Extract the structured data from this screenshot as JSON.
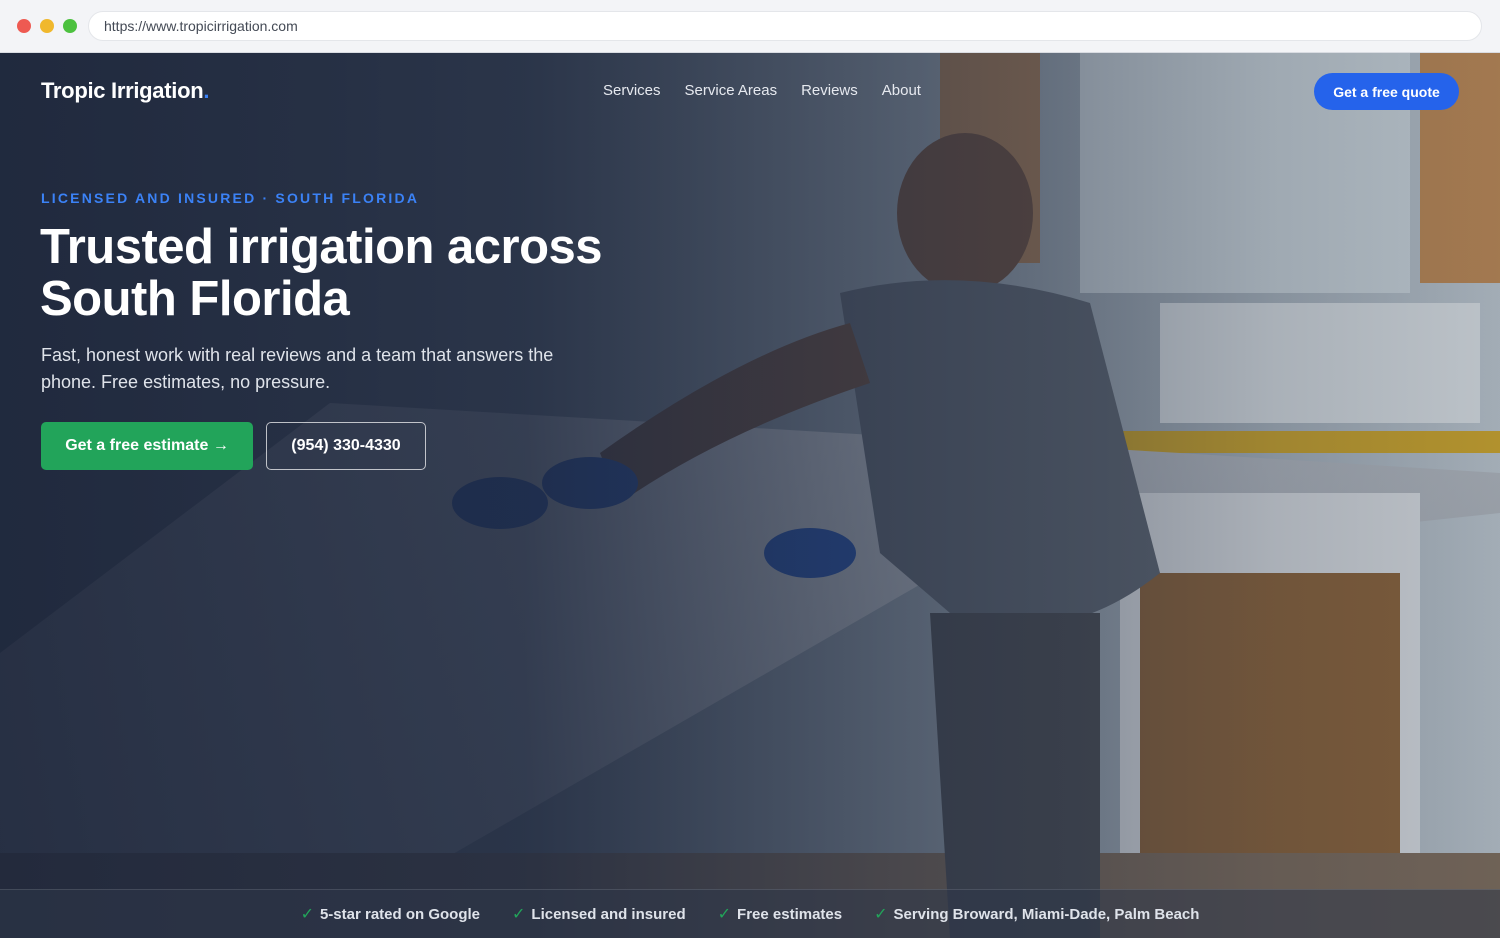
{
  "browser": {
    "url": "https://www.tropicirrigation.com"
  },
  "nav": {
    "logo": "Tropic Irrigation",
    "logo_dot": ".",
    "links": [
      "Services",
      "Service Areas",
      "Reviews",
      "About"
    ],
    "cta": "Get a free quote"
  },
  "hero": {
    "eyebrow": "LICENSED AND INSURED · SOUTH FLORIDA",
    "headline_line1": "Trusted irrigation across",
    "headline_line2": "South Florida",
    "subtitle": "Fast, honest work with real reviews and a team that answers the phone. Free estimates, no pressure.",
    "primary_cta": "Get a free estimate →",
    "secondary_cta": "(954) 330-4330"
  },
  "trust_bar": {
    "check_icon": "✓",
    "items": [
      "5-star rated on Google",
      "Licensed and insured",
      "Free estimates",
      "Serving Broward, Miami-Dade, Palm Beach"
    ]
  },
  "colors": {
    "accent_blue": "#2563eb",
    "eyebrow_blue": "#3b82f6",
    "cta_green": "#22a45a"
  }
}
